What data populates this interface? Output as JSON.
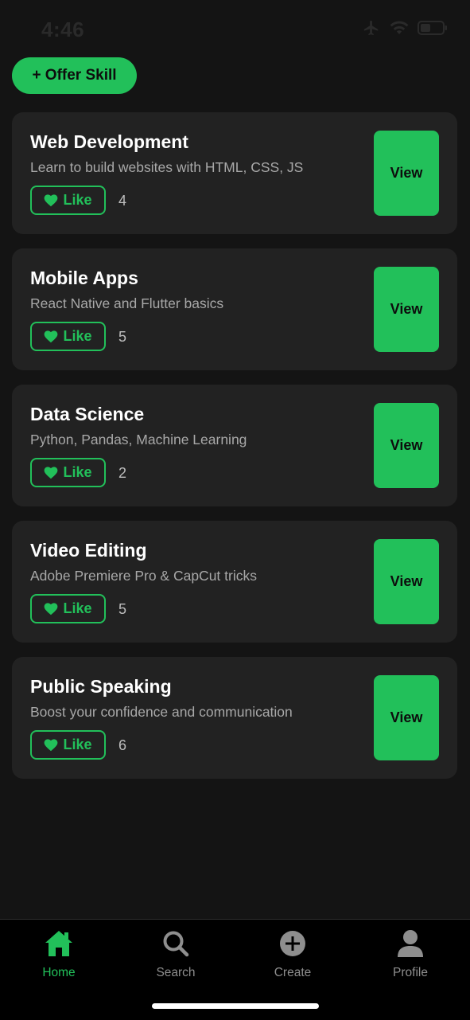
{
  "status_bar": {
    "time": "4:46"
  },
  "header": {
    "offer_label": "+ Offer Skill"
  },
  "skills": [
    {
      "title": "Web Development",
      "description": "Learn to build websites with HTML, CSS, JS",
      "like_label": "Like",
      "likes": "4",
      "view_label": "View"
    },
    {
      "title": "Mobile Apps",
      "description": "React Native and Flutter basics",
      "like_label": "Like",
      "likes": "5",
      "view_label": "View"
    },
    {
      "title": "Data Science",
      "description": "Python, Pandas, Machine Learning",
      "like_label": "Like",
      "likes": "2",
      "view_label": "View"
    },
    {
      "title": "Video Editing",
      "description": "Adobe Premiere Pro & CapCut tricks",
      "like_label": "Like",
      "likes": "5",
      "view_label": "View"
    },
    {
      "title": "Public Speaking",
      "description": "Boost your confidence and communication",
      "like_label": "Like",
      "likes": "6",
      "view_label": "View"
    }
  ],
  "tabs": [
    {
      "label": "Home",
      "icon": "home-icon",
      "active": true
    },
    {
      "label": "Search",
      "icon": "search-icon",
      "active": false
    },
    {
      "label": "Create",
      "icon": "plus-circle-icon",
      "active": false
    },
    {
      "label": "Profile",
      "icon": "person-icon",
      "active": false
    }
  ],
  "colors": {
    "accent": "#22c05a",
    "background": "#141414",
    "card": "#222222",
    "tab_bar": "#000000",
    "inactive": "#8e8e8e"
  }
}
